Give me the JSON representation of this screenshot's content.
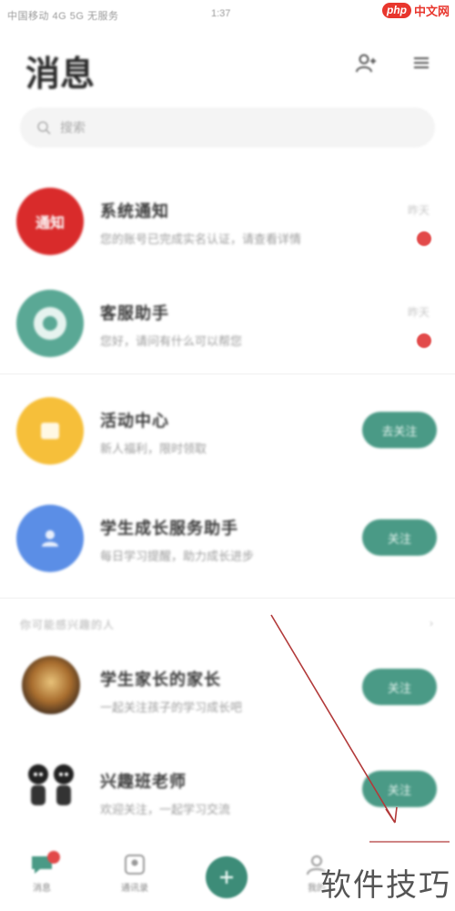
{
  "status_bar": {
    "left_text": "中国移动 4G 5G 无服务",
    "center_text": "1:37",
    "watermark_logo": "php",
    "watermark_site": "中文网"
  },
  "header": {
    "title": "消息",
    "add_friend_icon": "person-add-icon",
    "menu_icon": "menu-icon"
  },
  "search": {
    "placeholder": "搜索"
  },
  "conversations": [
    {
      "title": "系统通知",
      "subtitle": "您的账号已完成实名认证，请查看详情",
      "time": "昨天",
      "avatar_color": "#d92b2b",
      "avatar_text": "通知",
      "unread": true
    },
    {
      "title": "客服助手",
      "subtitle": "您好，请问有什么可以帮您",
      "time": "昨天",
      "avatar_color": "#5aa895",
      "avatar_text": "",
      "unread": true
    },
    {
      "title": "活动中心",
      "subtitle": "新人福利，限时领取",
      "button_label": "去关注",
      "avatar_color": "#f6bf3a",
      "avatar_text": ""
    },
    {
      "title": "学生成长服务助手",
      "subtitle": "每日学习提醒，助力成长进步",
      "button_label": "关注",
      "avatar_color": "#5b8ee6",
      "avatar_text": ""
    }
  ],
  "section": {
    "label": "你可能感兴趣的人",
    "chevron": "›"
  },
  "suggestions": [
    {
      "title": "学生家长的家长",
      "subtitle": "一起关注孩子的学习成长吧",
      "button_label": "关注"
    },
    {
      "title": "兴趣班老师",
      "subtitle": "欢迎关注，一起学习交流",
      "button_label": "关注"
    }
  ],
  "bottom_nav": {
    "items": [
      {
        "label": "消息",
        "icon": "chat-icon",
        "badge": true
      },
      {
        "label": "通讯录",
        "icon": "contacts-icon",
        "badge": false
      },
      {
        "label": "",
        "icon": "compose-icon",
        "badge": false
      },
      {
        "label": "我的",
        "icon": "profile-icon",
        "badge": false
      }
    ]
  },
  "footer_watermark": "软件技巧",
  "colors": {
    "accent": "#4a9a86",
    "unread": "#e24a4a",
    "arrow": "#b23a3a"
  }
}
